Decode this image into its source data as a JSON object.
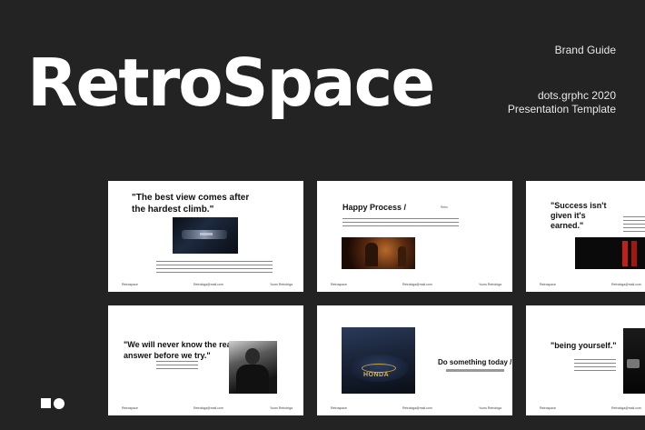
{
  "header": {
    "title": "RetroSpace",
    "brand_guide": "Brand Guide",
    "author": "dots.grphc 2020",
    "subtitle": "Presentation Template"
  },
  "slides": [
    {
      "quote": "\"The best view comes after the hardest climb.\"",
      "footer": [
        "Retrospace",
        "Retrobiga@mail.com",
        "Yours Retrobiga"
      ]
    },
    {
      "title": "Happy Process /",
      "tag": "Retro",
      "footer": [
        "Retrospace",
        "Retrobiga@mail.com",
        "Yours Retrobiga"
      ]
    },
    {
      "quote": "\"Success isn't given it's earned.\"",
      "footer": [
        "Retrospace",
        "Retrobiga@mail.com"
      ]
    },
    {
      "quote": "\"We will never know the real answer before we try.\"",
      "footer": [
        "Retrospace",
        "Retrobiga@mail.com",
        "Yours Retrobiga"
      ]
    },
    {
      "title": "Do something today /",
      "badge": "HONDA",
      "footer": [
        "Retrospace",
        "Retrobiga@mail.com",
        "Yours Retrobiga"
      ]
    },
    {
      "quote": "\"being yourself.\"",
      "footer": [
        "Retrospace",
        "Retrobiga@mail.com"
      ]
    }
  ],
  "icons": [
    "logo-square-icon",
    "logo-circle-icon"
  ],
  "colors": {
    "background": "#232323",
    "slide": "#ffffff",
    "text": "#111111"
  }
}
